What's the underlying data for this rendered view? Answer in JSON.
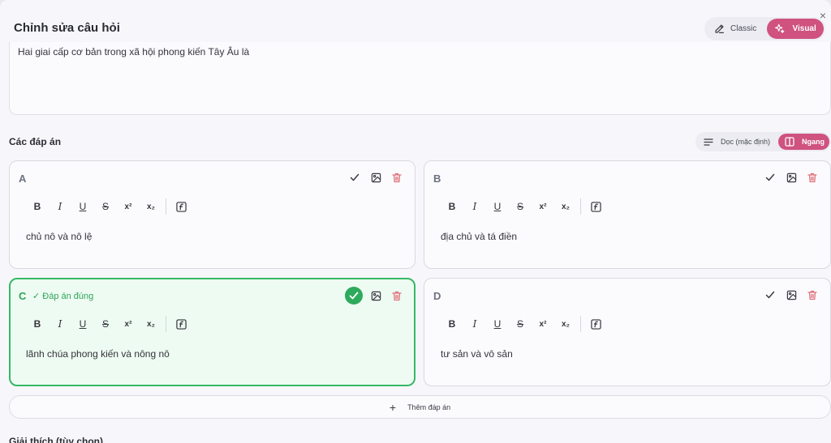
{
  "modal": {
    "title": "Chỉnh sửa câu hỏi",
    "close": "×"
  },
  "mode_toggle": {
    "classic_label": "Classic",
    "visual_label": "Visual",
    "active": "Visual"
  },
  "question": {
    "text": "Hai giai cấp cơ bản trong xã hội phong kiến Tây Âu là"
  },
  "answers_section": {
    "title": "Các đáp án",
    "layout_toggle": {
      "vertical_label": "Dọc (mặc định)",
      "horizontal_label": "Ngang",
      "active": "Ngang"
    },
    "toolbar": {
      "bold": "B",
      "italic": "I",
      "underline": "U",
      "strike": "S",
      "superscript": "x²",
      "subscript": "x₂"
    },
    "answers": [
      {
        "letter": "A",
        "text": "chủ nô và nô lệ",
        "correct": false
      },
      {
        "letter": "B",
        "text": "địa chủ và tá điền",
        "correct": false
      },
      {
        "letter": "C",
        "text": "lãnh chúa phong kiến và nông nô",
        "correct": true,
        "correct_label": "✓ Đáp án đúng"
      },
      {
        "letter": "D",
        "text": "tư sản và vô sản",
        "correct": false
      }
    ],
    "add_answer_label": "Thêm đáp án"
  },
  "explanation": {
    "title": "Giải thích (tùy chọn)"
  },
  "colors": {
    "accent": "#cf527f",
    "correct": "#36b865",
    "delete": "#e0707a"
  }
}
